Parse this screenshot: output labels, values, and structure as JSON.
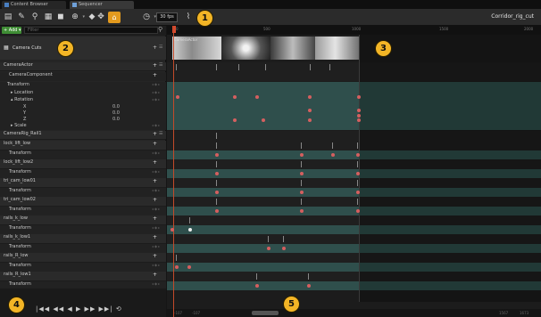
{
  "tabs": [
    {
      "label": "Content Browser"
    },
    {
      "label": "Sequencer"
    }
  ],
  "toolbar": {
    "fps": "30 fps",
    "sequence_name": "Corridor_rig_cut",
    "icons": [
      "save-icon",
      "save-as-icon",
      "search-icon",
      "snap-icon",
      "camera-icon",
      "playback-icon",
      "key-icon",
      "transform-icon",
      "camera-lock-icon",
      "clock-icon",
      "curve-icon"
    ]
  },
  "callouts": [
    "1",
    "2",
    "3",
    "4",
    "5"
  ],
  "left": {
    "add_label": "+ Add ▾",
    "filter_placeholder": "Filter",
    "camera_cuts_label": "Camera Cuts",
    "camera_actor": "CameraActor",
    "camera_component": "CameraComponent",
    "transform": "Transform",
    "location": "▸ Location",
    "rotation": "▴ Rotation",
    "rotation_x": "X",
    "rotation_y": "Y",
    "rotation_z": "Z",
    "rotation_x_val": "0.0",
    "rotation_y_val": "0.0",
    "rotation_z_val": "0.0",
    "scale": "▸ Scale",
    "camera_rig": "CameraRig_Rail1",
    "tracks": [
      {
        "name": "lock_lift_low",
        "child": "Transform"
      },
      {
        "name": "lock_lift_low2",
        "child": "Transform"
      },
      {
        "name": "tri_cam_low01",
        "child": "Transform"
      },
      {
        "name": "tri_cam_low02",
        "child": "Transform"
      },
      {
        "name": "rails_k_low",
        "child": "Transform"
      },
      {
        "name": "rails_k_low1",
        "child": "Transform"
      },
      {
        "name": "rails_R_low",
        "child": "Transform"
      },
      {
        "name": "rails_R_low1",
        "child": "Transform"
      }
    ]
  },
  "transport": {
    "controls": "|◀◀ ◀◀ ◀ ▶ ▶▶ ▶▶| ⟲"
  },
  "timeline": {
    "ruler_labels": [
      "0",
      "500",
      "1000",
      "1500",
      "2000"
    ],
    "camera_cut_title": "CameraActor",
    "scroll_start": "-107",
    "scroll_start2": "-107",
    "scroll_end": "1567",
    "scroll_end2": "1673"
  },
  "colors": {
    "accent": "#e39a1e",
    "add_button": "#3f8d35",
    "playhead": "#c34a2a",
    "lane_teal": "#2f4f4c",
    "key": "#d55f5f",
    "callout": "#f3b526"
  }
}
